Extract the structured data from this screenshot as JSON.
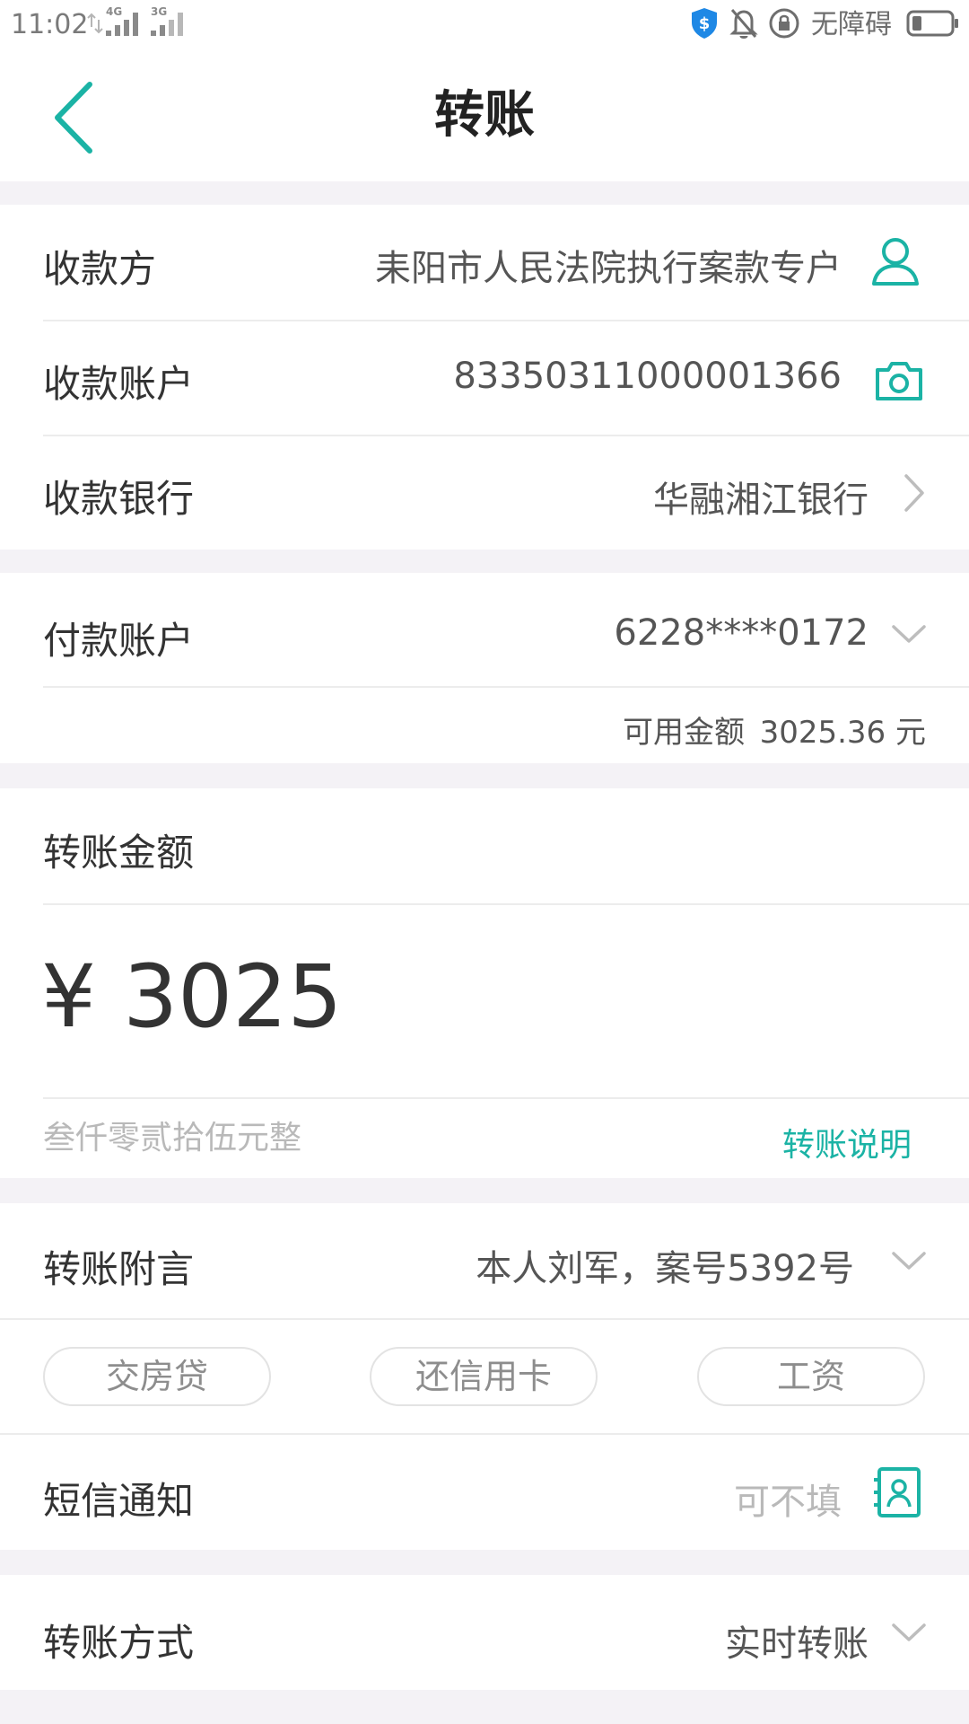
{
  "status_bar": {
    "time": "11:02",
    "signal1_tag": "4G",
    "signal2_tag": "3G",
    "accessibility_text": "无障碍"
  },
  "header": {
    "title": "转账"
  },
  "payee_card": {
    "payee_label": "收款方",
    "payee_value": "耒阳市人民法院执行案款专户",
    "account_label": "收款账户",
    "account_value": "83350311000001366",
    "bank_label": "收款银行",
    "bank_value": "华融湘江银行"
  },
  "payer_card": {
    "account_label": "付款账户",
    "account_value": "6228****0172",
    "available_label": "可用金额",
    "available_value": "3025.36 元"
  },
  "amount_card": {
    "label": "转账金额",
    "currency_symbol": "¥",
    "amount_value": "3025",
    "amount_in_words": "叁仟零贰拾伍元整",
    "explanation_link": "转账说明"
  },
  "remark_card": {
    "remark_label": "转账附言",
    "remark_value": "本人刘军，案号5392号",
    "chips": [
      "交房贷",
      "还信用卡",
      "工资"
    ],
    "sms_label": "短信通知",
    "sms_placeholder": "可不填"
  },
  "method_card": {
    "label": "转账方式",
    "value": "实时转账"
  },
  "colors": {
    "accent": "#1bb3a5",
    "background": "#f4f2f6",
    "card": "#ffffff",
    "text_primary": "#333333",
    "text_secondary": "#555555",
    "text_hint": "#b9b9b9"
  }
}
